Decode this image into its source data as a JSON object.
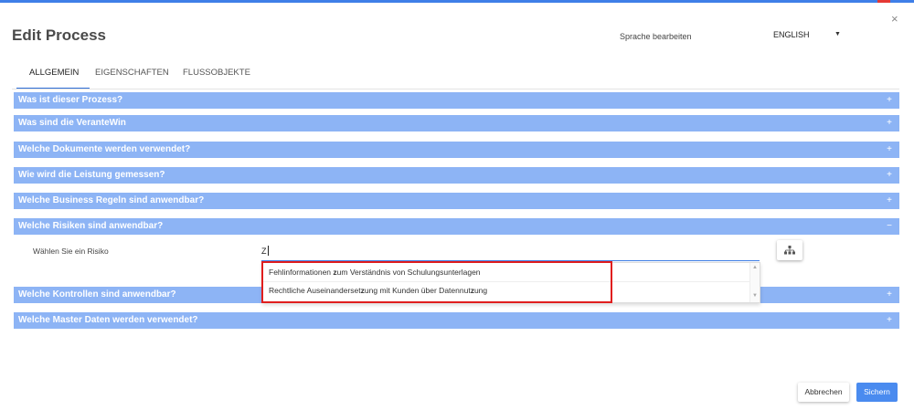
{
  "dialog": {
    "title": "Edit Process",
    "close_symbol": "×"
  },
  "language": {
    "label": "Sprache bearbeiten",
    "selected": "ENGLISH",
    "caret_icon": "caret-down-icon"
  },
  "tabs": [
    {
      "label": "ALLGEMEIN",
      "active": true
    },
    {
      "label": "EIGENSCHAFTEN",
      "active": false
    },
    {
      "label": "FLUSSOBJEKTE",
      "active": false
    }
  ],
  "sections": [
    {
      "label": "Was ist dieser Prozess?",
      "symbol": "+"
    },
    {
      "label": "Was sind die VeranteWin",
      "symbol": "+"
    },
    {
      "label": "Welche Dokumente werden verwendet?",
      "symbol": "+"
    },
    {
      "label": "Wie wird die Leistung gemessen?",
      "symbol": "+"
    },
    {
      "label": "Welche Business Regeln sind anwendbar?",
      "symbol": "+"
    },
    {
      "label": "Welche Risiken sind anwendbar?",
      "symbol": "−"
    },
    {
      "label": "Welche Kontrollen sind anwendbar?",
      "symbol": "+"
    },
    {
      "label": "Welche Master Daten werden verwendet?",
      "symbol": "+"
    }
  ],
  "risk": {
    "label": "Wählen Sie ein Risiko",
    "input_value": "Z",
    "tree_icon": "hierarchy-icon"
  },
  "suggestions": [
    {
      "before": "Fehlinformationen ",
      "match": "z",
      "after": "um Verständnis von Schulungsunterlagen"
    },
    {
      "before": "Rechtliche Auseinanderset",
      "match": "z",
      "mid": "ung mit Kunden über Datennut",
      "match2": "z",
      "after": "ung"
    }
  ],
  "footer": {
    "cancel_label": "Abbrechen",
    "save_label": "Sichern"
  },
  "colors": {
    "accent": "#3f7fe8",
    "section_header": "#8db4f5",
    "highlight_box": "#e01e1e",
    "save_button": "#4a8bef"
  }
}
